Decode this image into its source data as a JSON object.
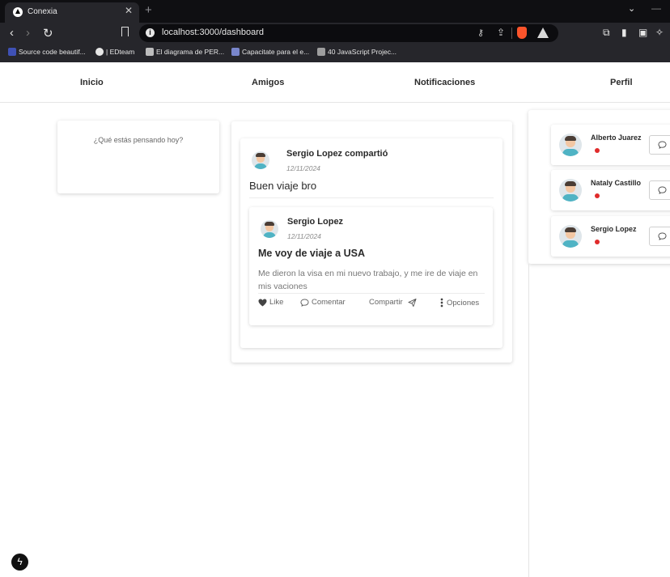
{
  "browser": {
    "tab_title": "Conexia",
    "url": "localhost:3000/dashboard",
    "bookmarks": [
      {
        "label": "Source code beautif...",
        "color": "#3f51b5"
      },
      {
        "label": "| EDteam",
        "color": "#e6e6e6"
      },
      {
        "label": "El diagrama de PER...",
        "color": "#bdbdbd"
      },
      {
        "label": "Capacitate para el e...",
        "color": "#7986cb"
      },
      {
        "label": "40 JavaScript Projec...",
        "color": "#9e9e9e"
      }
    ]
  },
  "nav": {
    "items": [
      "Inicio",
      "Amigos",
      "Notificaciones",
      "Perfil"
    ]
  },
  "compose": {
    "placeholder": "¿Qué estás pensando hoy?"
  },
  "feed": {
    "shared_post": {
      "author_line": "Sergio Lopez compartió",
      "date": "12/11/2024",
      "text": "Buen viaje bro",
      "original": {
        "author": "Sergio Lopez",
        "date": "12/11/2024",
        "title": "Me voy de viaje a USA",
        "body": "Me dieron la visa en mi nuevo trabajo, y me ire de viaje en mis vaciones",
        "actions": {
          "like": "Like",
          "comment": "Comentar",
          "share": "Compartir",
          "options": "Opciones"
        }
      }
    }
  },
  "friends": [
    {
      "name": "Alberto Juarez",
      "status_color": "#e02b2b"
    },
    {
      "name": "Nataly Castillo",
      "status_color": "#e02b2b"
    },
    {
      "name": "Sergio Lopez",
      "status_color": "#e02b2b"
    }
  ],
  "dev_badge": {
    "icon": "lightning-icon"
  }
}
